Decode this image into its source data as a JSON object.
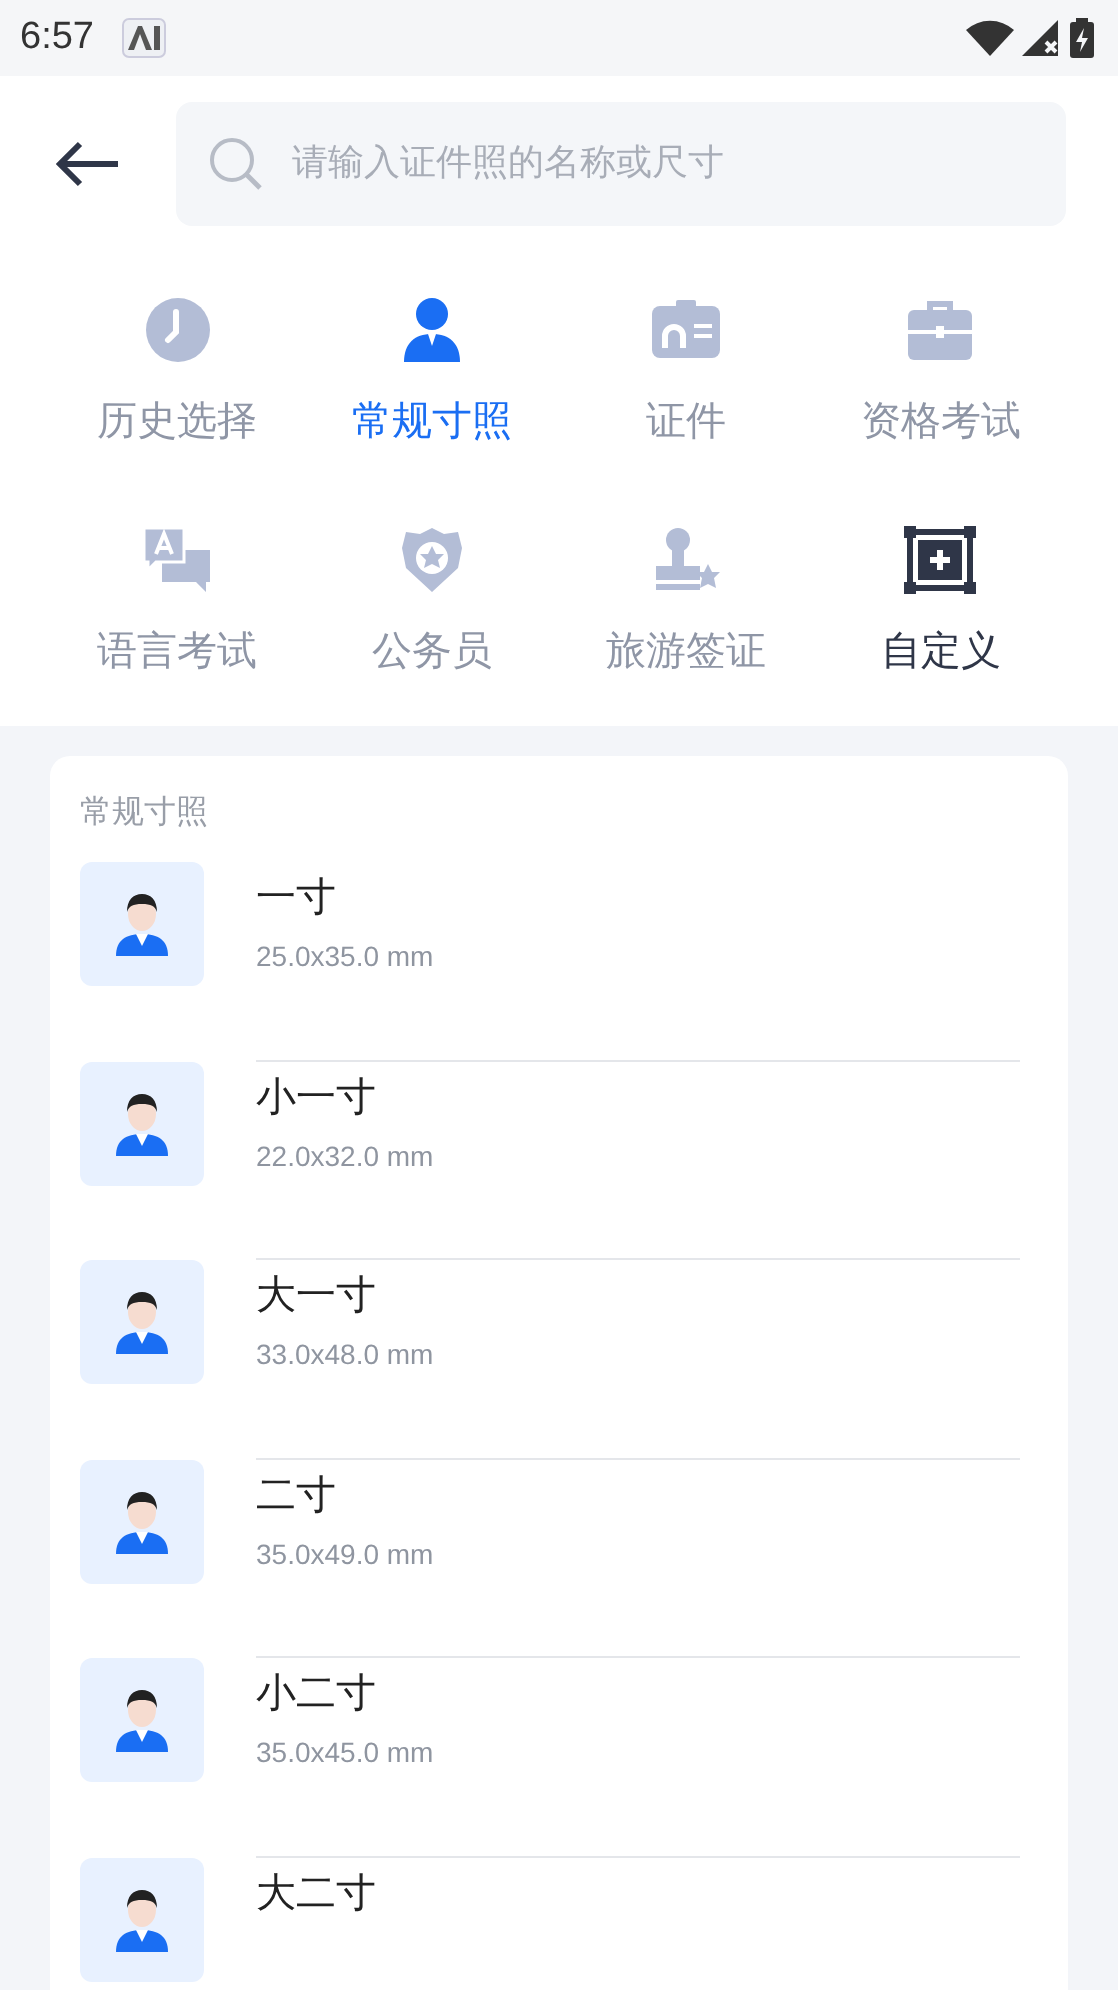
{
  "status_bar": {
    "time": "6:57"
  },
  "search": {
    "placeholder": "请输入证件照的名称或尺寸"
  },
  "categories": [
    {
      "label": "历史选择",
      "kind": "history",
      "selected": false
    },
    {
      "label": "常规寸照",
      "kind": "portrait",
      "selected": true
    },
    {
      "label": "证件",
      "kind": "id",
      "selected": false
    },
    {
      "label": "资格考试",
      "kind": "exam",
      "selected": false
    },
    {
      "label": "语言考试",
      "kind": "language",
      "selected": false
    },
    {
      "label": "公务员",
      "kind": "civil",
      "selected": false
    },
    {
      "label": "旅游签证",
      "kind": "visa",
      "selected": false
    },
    {
      "label": "自定义",
      "kind": "custom",
      "selected": false
    }
  ],
  "section": {
    "title": "常规寸照",
    "items": [
      {
        "name": "一寸",
        "size": "25.0x35.0 mm"
      },
      {
        "name": "小一寸",
        "size": "22.0x32.0 mm"
      },
      {
        "name": "大一寸",
        "size": "33.0x48.0 mm"
      },
      {
        "name": "二寸",
        "size": "35.0x49.0 mm"
      },
      {
        "name": "小二寸",
        "size": "35.0x45.0 mm"
      },
      {
        "name": "大二寸"
      }
    ]
  }
}
